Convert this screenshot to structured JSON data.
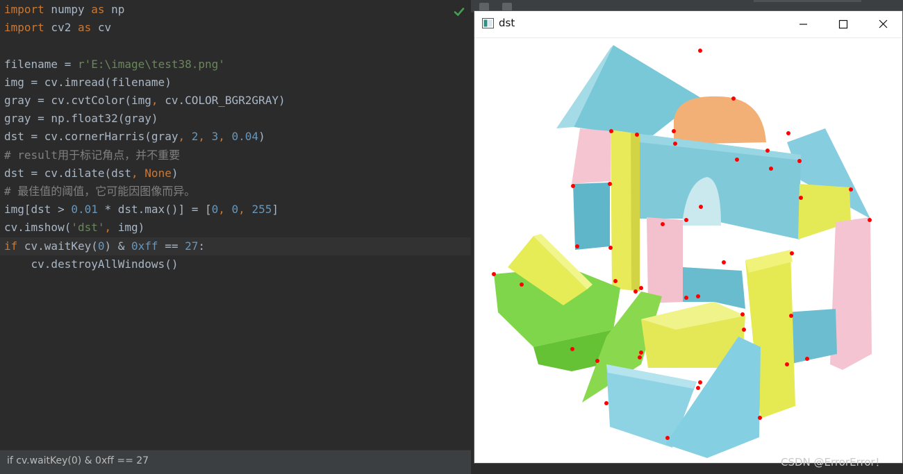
{
  "editor": {
    "lines": [
      {
        "parts": [
          {
            "t": "import",
            "c": "kw"
          },
          {
            "t": " numpy ",
            "c": ""
          },
          {
            "t": "as",
            "c": "kw"
          },
          {
            "t": " np",
            "c": ""
          }
        ]
      },
      {
        "parts": [
          {
            "t": "import",
            "c": "kw"
          },
          {
            "t": " cv2 ",
            "c": ""
          },
          {
            "t": "as",
            "c": "kw"
          },
          {
            "t": " cv",
            "c": ""
          }
        ]
      },
      {
        "parts": []
      },
      {
        "parts": [
          {
            "t": "filename = ",
            "c": ""
          },
          {
            "t": "r'E:\\image\\test38.png'",
            "c": "str"
          }
        ]
      },
      {
        "parts": [
          {
            "t": "img = cv.imread(filename)",
            "c": ""
          }
        ]
      },
      {
        "parts": [
          {
            "t": "gray = cv.cvtColor(img",
            "c": ""
          },
          {
            "t": ",",
            "c": "kw"
          },
          {
            "t": " cv.COLOR_BGR2GRAY)",
            "c": ""
          }
        ]
      },
      {
        "parts": [
          {
            "t": "gray = np.float32(gray)",
            "c": ""
          }
        ]
      },
      {
        "parts": [
          {
            "t": "dst = cv.cornerHarris(gray",
            "c": ""
          },
          {
            "t": ", ",
            "c": "kw"
          },
          {
            "t": "2",
            "c": "num"
          },
          {
            "t": ", ",
            "c": "kw"
          },
          {
            "t": "3",
            "c": "num"
          },
          {
            "t": ", ",
            "c": "kw"
          },
          {
            "t": "0.04",
            "c": "num"
          },
          {
            "t": ")",
            "c": ""
          }
        ]
      },
      {
        "parts": [
          {
            "t": "# result用于标记角点，并不重要",
            "c": "cmt"
          }
        ]
      },
      {
        "parts": [
          {
            "t": "dst = cv.dilate(dst",
            "c": ""
          },
          {
            "t": ", ",
            "c": "kw"
          },
          {
            "t": "None",
            "c": "kw"
          },
          {
            "t": ")",
            "c": ""
          }
        ]
      },
      {
        "parts": [
          {
            "t": "# 最佳值的阈值，它可能因图像而异。",
            "c": "cmt"
          }
        ]
      },
      {
        "parts": [
          {
            "t": "img[dst > ",
            "c": ""
          },
          {
            "t": "0.01",
            "c": "num"
          },
          {
            "t": " * dst.max()] = [",
            "c": ""
          },
          {
            "t": "0",
            "c": "num"
          },
          {
            "t": ", ",
            "c": "kw"
          },
          {
            "t": "0",
            "c": "num"
          },
          {
            "t": ", ",
            "c": "kw"
          },
          {
            "t": "255",
            "c": "num"
          },
          {
            "t": "]",
            "c": ""
          }
        ]
      },
      {
        "parts": [
          {
            "t": "cv.imshow(",
            "c": ""
          },
          {
            "t": "'dst'",
            "c": "str"
          },
          {
            "t": ", ",
            "c": "kw"
          },
          {
            "t": "img)",
            "c": ""
          }
        ]
      },
      {
        "parts": [
          {
            "t": "if",
            "c": "kw"
          },
          {
            "t": " cv.waitKey(",
            "c": ""
          },
          {
            "t": "0",
            "c": "num"
          },
          {
            "t": ") & ",
            "c": ""
          },
          {
            "t": "0xff",
            "c": "num"
          },
          {
            "t": " == ",
            "c": ""
          },
          {
            "t": "27",
            "c": "num"
          },
          {
            "t": ":",
            "c": ""
          }
        ]
      },
      {
        "parts": [
          {
            "t": "    cv.destroyAllWindows()",
            "c": ""
          }
        ]
      }
    ]
  },
  "status_bar": {
    "text": "if cv.waitKey(0) & 0xff == 27"
  },
  "window": {
    "title": "dst"
  },
  "watermark": "CSDN @ErrorError！"
}
